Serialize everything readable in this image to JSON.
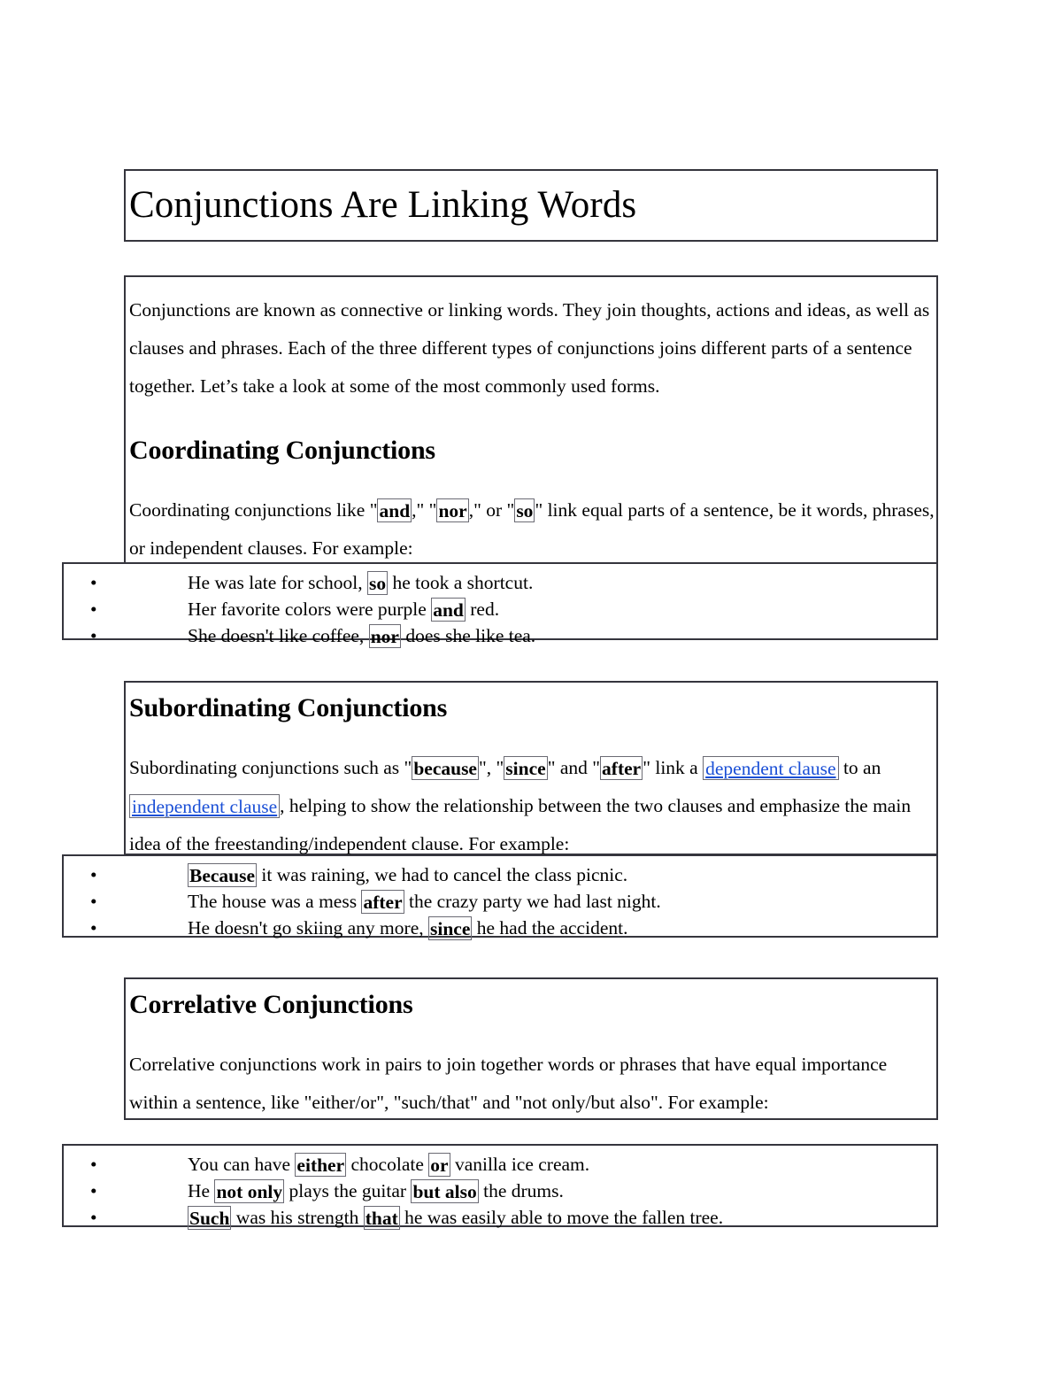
{
  "document": {
    "title": "Conjunctions Are Linking Words"
  },
  "intro": {
    "text": "Conjunctions are known as connective or linking words. They join thoughts, actions and ideas, as well as clauses and phrases. Each of the three different types of conjunctions joins different parts of a sentence together. Let’s take a look at some of the most commonly used forms."
  },
  "coordinating": {
    "heading": "Coordinating Conjunctions",
    "para_1": "Coordinating conjunctions like \"",
    "kw_and": "and",
    "para_2": ",\" \"",
    "kw_nor": "nor",
    "para_3": ",\" or \"",
    "kw_so": "so",
    "para_4": "\" link equal parts of a sentence, be it words, phrases, or independent clauses. For example:",
    "examples": [
      {
        "bullet": "•",
        "pre": "He was late for school, ",
        "kw": "so",
        "post": " he took a shortcut."
      },
      {
        "bullet": "•",
        "pre": "Her favorite colors were purple ",
        "kw": "and",
        "post": " red."
      },
      {
        "bullet": "•",
        "pre": "She doesn't like coffee, ",
        "kw": "nor",
        "post": " does she like tea."
      }
    ]
  },
  "subordinating": {
    "heading": "Subordinating Conjunctions",
    "para_1": "Subordinating conjunctions such as \"",
    "kw_because": "because",
    "para_2": "\", \"",
    "kw_since": "since",
    "para_3": "\" and \"",
    "kw_after": "after",
    "para_4": "\" link a ",
    "link_dependent": "dependent clause",
    "para_5": " to an ",
    "link_independent": "independent clause",
    "para_6": ", helping to show the relationship between the two clauses and emphasize the main idea of the freestanding/independent clause. For example:",
    "examples": [
      {
        "bullet": "•",
        "pre": "",
        "kw": "Because",
        "post": " it was raining, we had to cancel the class picnic."
      },
      {
        "bullet": "•",
        "pre": "The house was a mess ",
        "kw": "after",
        "post": " the crazy party we had last night."
      },
      {
        "bullet": "•",
        "pre": "He doesn't go skiing any more, ",
        "kw": "since",
        "post": " he had the accident."
      }
    ]
  },
  "correlative": {
    "heading": "Correlative Conjunctions",
    "para": "Correlative conjunctions work in pairs to join together words or phrases that have equal importance within a sentence, like \"either/or\", \"such/that\" and \"not only/but also\". For example:",
    "examples": [
      {
        "bullet": "•",
        "pre": "You can have ",
        "kw": "either",
        "mid": " chocolate ",
        "kw2": "or",
        "post": " vanilla ice cream."
      },
      {
        "bullet": "•",
        "pre": "He ",
        "kw": "not only",
        "mid": " plays the guitar ",
        "kw2": "but also",
        "post": " the drums."
      },
      {
        "bullet": "•",
        "pre": "",
        "kw": "Such",
        "mid": " was his strength ",
        "kw2": "that",
        "post": " he was easily able to move the fallen tree."
      }
    ]
  },
  "colors": {
    "link": "#1a4fd6",
    "border": "#35353d",
    "token_border": "#6b6b74",
    "text": "#000000",
    "background": "#ffffff"
  }
}
